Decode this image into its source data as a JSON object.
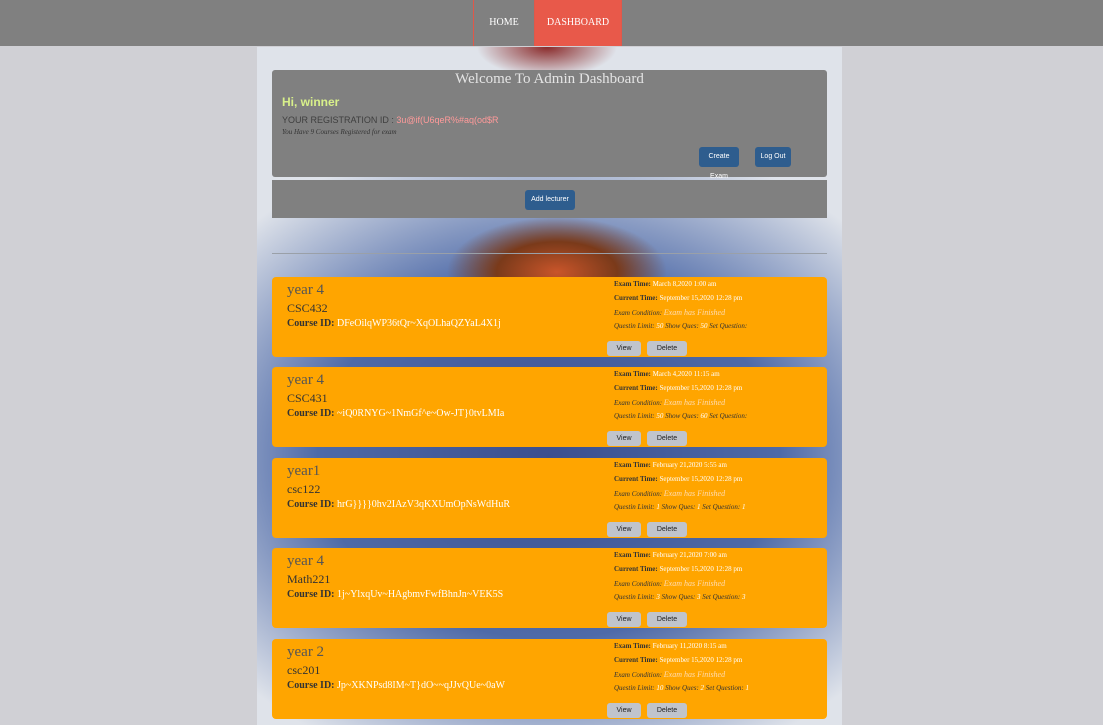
{
  "nav": {
    "home": "HOME",
    "dashboard": "DASHBOARD"
  },
  "welcome": {
    "title": "Welcome To Admin Dashboard",
    "greeting": "Hi, winner",
    "reg_label": "YOUR REGISTRATION ID : ",
    "reg_value": "3u@if(U6qeR%#aq(od$R",
    "courses_note": "You Have 9 Courses Registered for exam",
    "create_exam": "Create Exam",
    "logout": "Log Out"
  },
  "add_lecturer": "Add lecturer",
  "labels": {
    "course_id": "Course ID:",
    "exam_time": "Exam Time:",
    "current_time": "Current Time:",
    "exam_condition": "Exam Condition:",
    "limit": "Questin Limit:",
    "show": "Show Ques:",
    "set": "Set Question:",
    "view": "View",
    "delete": "Delete"
  },
  "courses": [
    {
      "year": "year 4",
      "code": "CSC432",
      "course_id": "DFeOilqWP36tQr~XqOLhaQZYaL4X1j",
      "exam_time": "March 8,2020 1:00 am",
      "current_time": "September 15,2020 12:28 pm",
      "condition": "Exam has Finished",
      "limit": "50",
      "show": "50",
      "set": ""
    },
    {
      "year": "year 4",
      "code": "CSC431",
      "course_id": "~iQ0RNYG~1NmGf^e~Ow-JT}0tvLMIa",
      "exam_time": "March 4,2020 11:15 am",
      "current_time": "September 15,2020 12:28 pm",
      "condition": "Exam has Finished",
      "limit": "50",
      "show": "60",
      "set": ""
    },
    {
      "year": "year1",
      "code": "csc122",
      "course_id": "hrG}}}}0hv2IAzV3qKXUmOpNsWdHuR",
      "exam_time": "February 21,2020 5:55 am",
      "current_time": "September 15,2020 12:28 pm",
      "condition": "Exam has Finished",
      "limit": "1",
      "show": "1",
      "set": "1"
    },
    {
      "year": "year 4",
      "code": "Math221",
      "course_id": "1j~YlxqUv~HAgbmvFwfBhnJn~VEK5S",
      "exam_time": "February 21,2020 7:00 am",
      "current_time": "September 15,2020 12:28 pm",
      "condition": "Exam has Finished",
      "limit": "3",
      "show": "3",
      "set": "3"
    },
    {
      "year": "year 2",
      "code": "csc201",
      "course_id": "Jp~XKNPsd8IM~T}dO~~qJJvQUe~0aW",
      "exam_time": "February 11,2020 8:15 am",
      "current_time": "September 15,2020 12:28 pm",
      "condition": "Exam has Finished",
      "limit": "10",
      "show": "2",
      "set": "1"
    }
  ]
}
